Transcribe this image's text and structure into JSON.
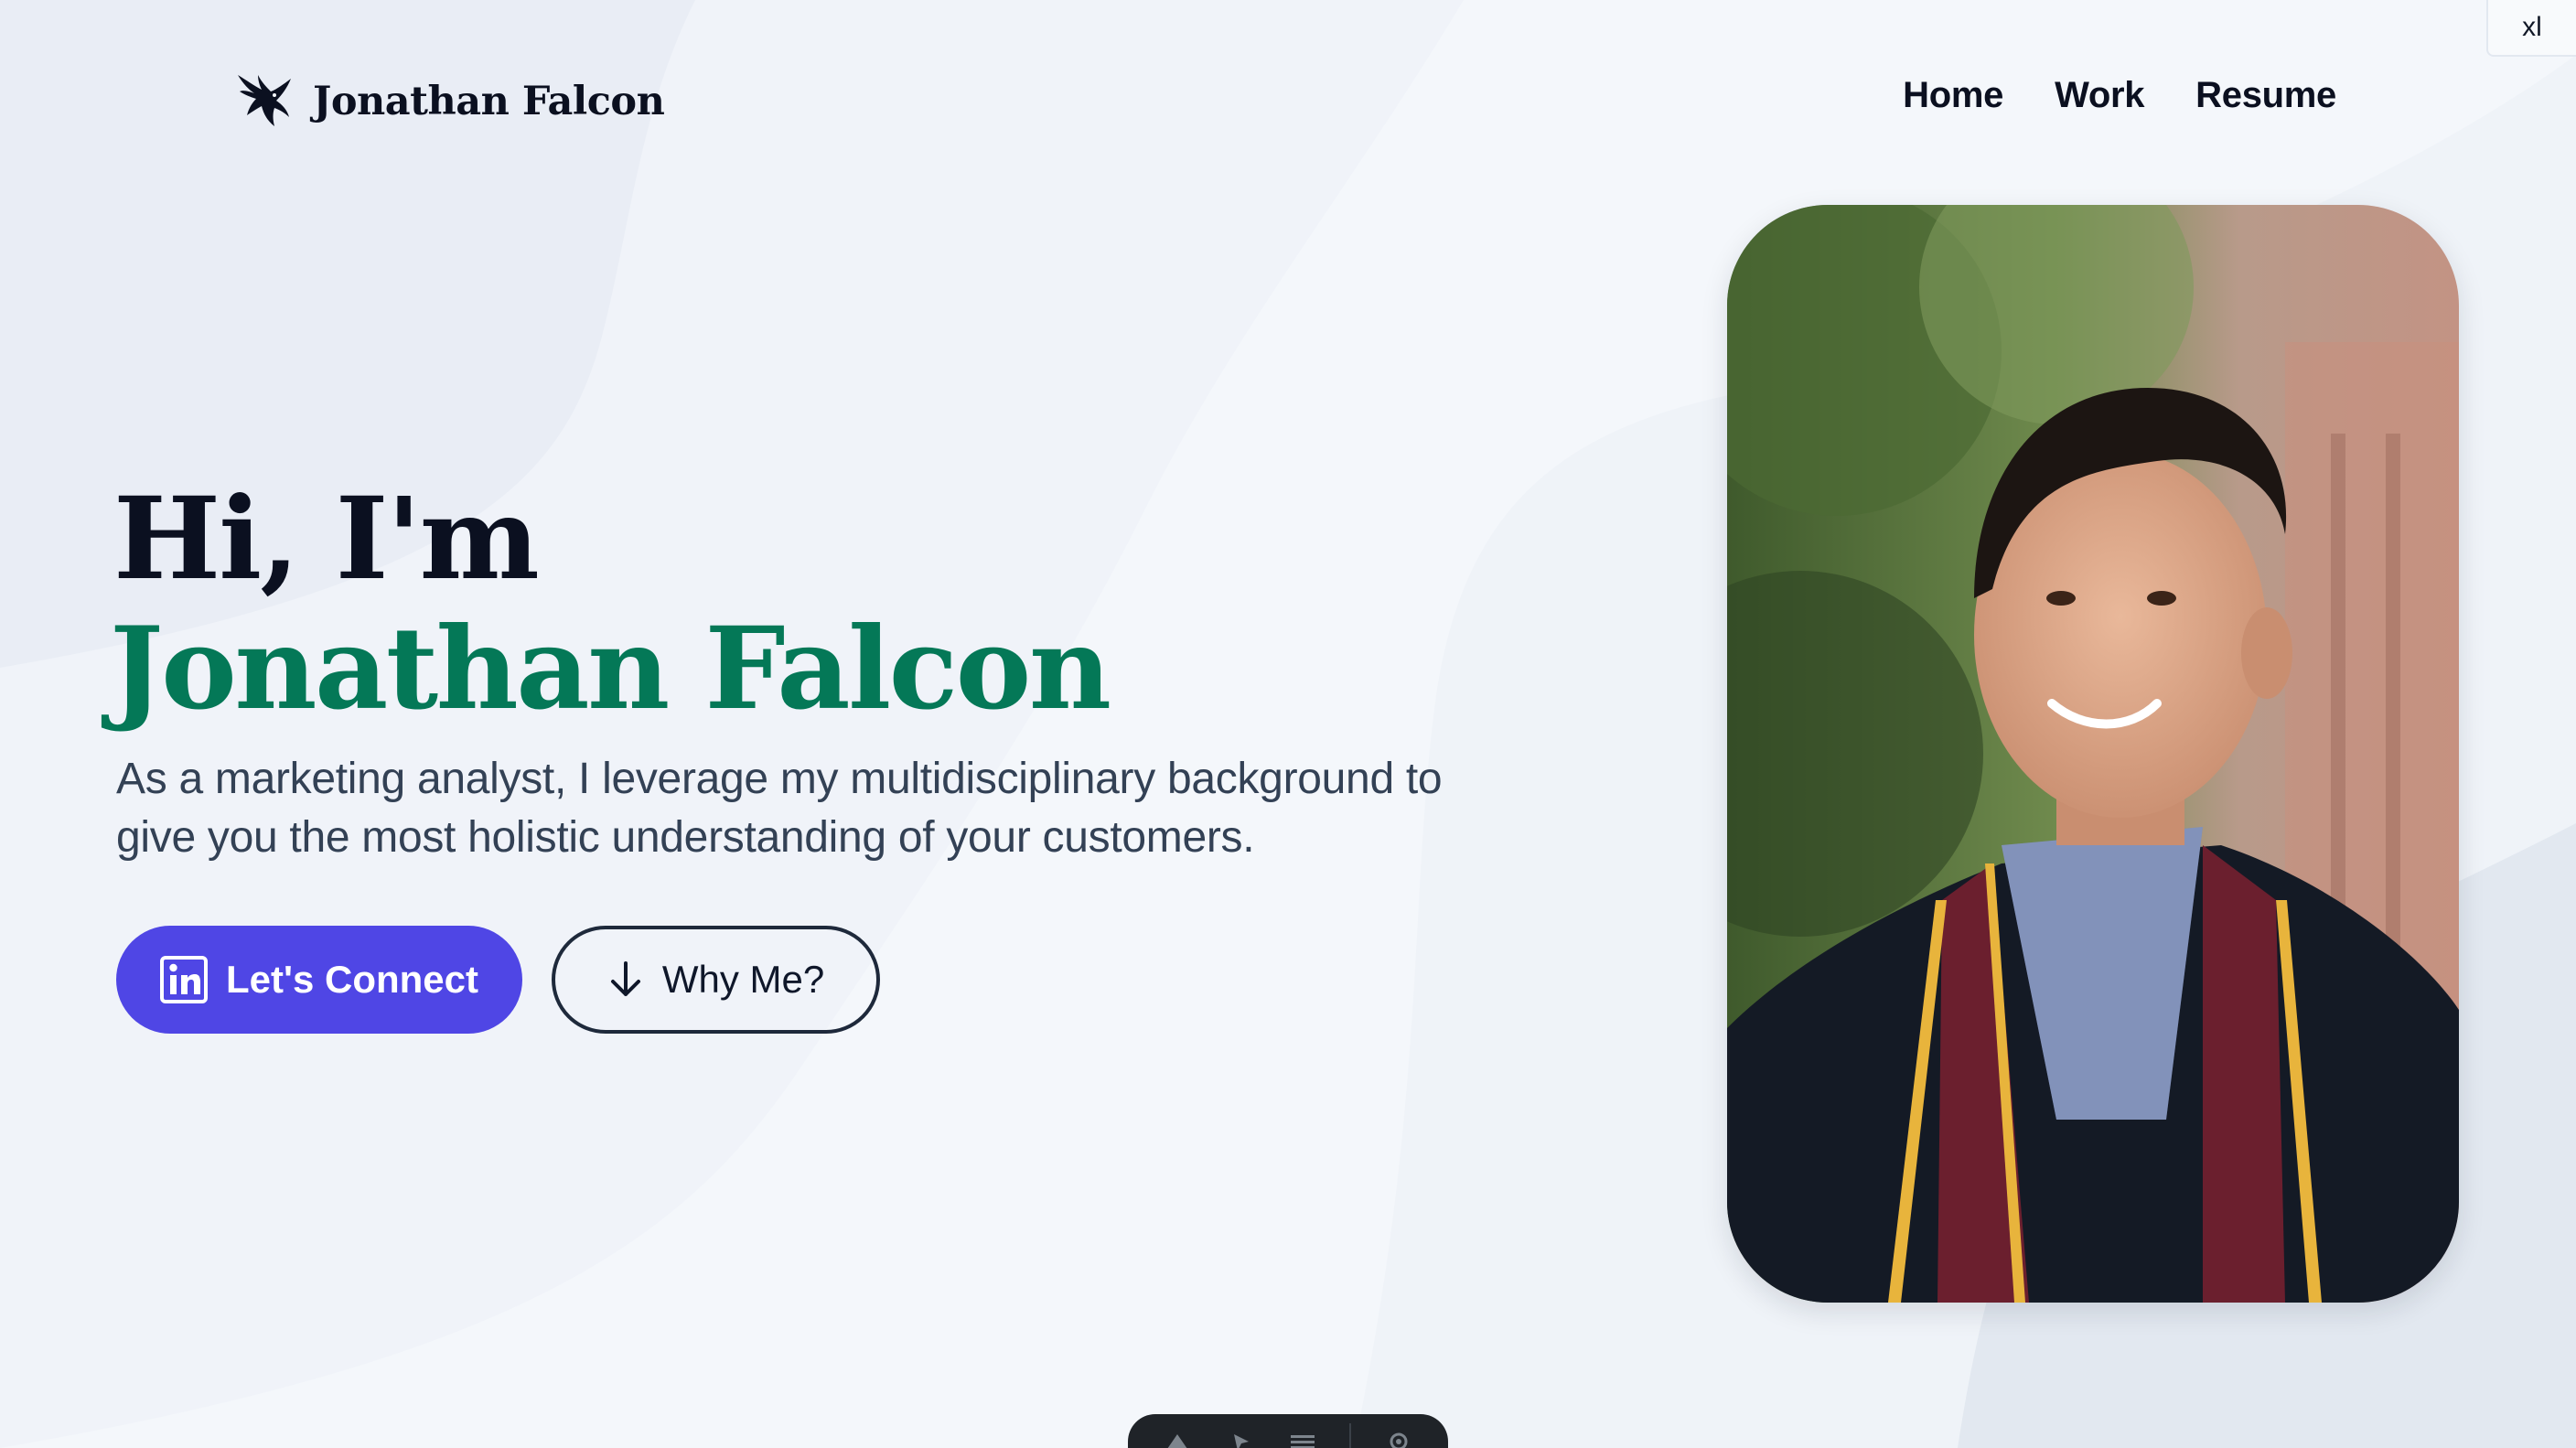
{
  "breakpoint_badge": "xl",
  "header": {
    "logo_text": "Jonathan Falcon",
    "logo_icon": "falcon-icon",
    "nav": [
      {
        "label": "Home"
      },
      {
        "label": "Work"
      },
      {
        "label": "Resume"
      }
    ]
  },
  "hero": {
    "greeting": "Hi, I'm",
    "name": "Jonathan Falcon",
    "description": "As a marketing analyst, I leverage my multidisciplinary background to give you the most holistic understanding of your customers.",
    "primary_button": {
      "label": "Let's Connect",
      "icon": "linkedin-icon"
    },
    "secondary_button": {
      "label": "Why Me?",
      "icon": "arrow-down-icon"
    },
    "photo": "portrait-photo"
  },
  "dock": {
    "items": [
      "tool-icon",
      "pointer-icon",
      "menu-icon",
      "settings-icon"
    ]
  },
  "colors": {
    "background": "#f4f7fb",
    "accent_green": "#047857",
    "primary_button": "#4f46e5",
    "text_dark": "#0b1020",
    "text_body": "#334155"
  }
}
